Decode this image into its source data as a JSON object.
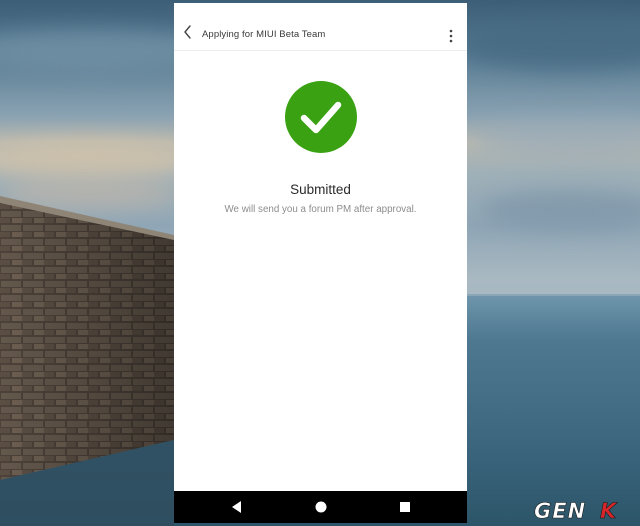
{
  "header": {
    "title": "Applying for MIUI Beta Team",
    "back_icon": "chevron-left-icon",
    "menu_icon": "more-vertical-icon"
  },
  "status": {
    "icon": "check-circle-icon",
    "headline": "Submitted",
    "message": "We will send you a forum PM after approval."
  },
  "navigation": {
    "back_icon": "nav-back-icon",
    "home_icon": "nav-home-icon",
    "recents_icon": "nav-recents-icon"
  },
  "watermark": {
    "text": "GENK"
  },
  "colors": {
    "success_green": "#3aa212",
    "navbar": "#000000",
    "title_text": "#3a3a3a",
    "sub_text": "#8d8d8d",
    "watermark_accent": "#d8262a"
  }
}
